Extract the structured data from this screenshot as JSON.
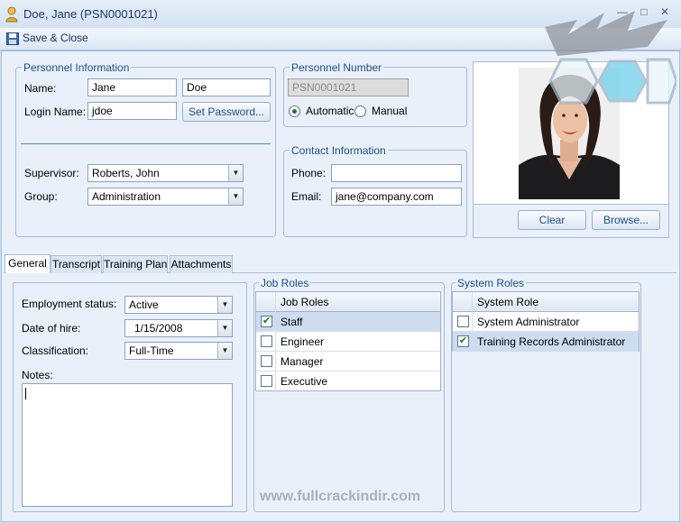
{
  "window": {
    "title": "Doe, Jane (PSN0001021)"
  },
  "toolbar": {
    "save_close": "Save & Close"
  },
  "personnel": {
    "legend": "Personnel Information",
    "name_label": "Name:",
    "first_name": "Jane",
    "last_name": "Doe",
    "login_label": "Login Name:",
    "login": "jdoe",
    "set_password": "Set Password...",
    "supervisor_label": "Supervisor:",
    "supervisor": "Roberts, John",
    "group_label": "Group:",
    "group": "Administration"
  },
  "personnel_number": {
    "legend": "Personnel Number",
    "value": "PSN0001021",
    "automatic": "Automatic",
    "manual": "Manual",
    "selected": "Automatic"
  },
  "contact": {
    "legend": "Contact Information",
    "phone_label": "Phone:",
    "phone": "",
    "email_label": "Email:",
    "email": "jane@company.com"
  },
  "photo": {
    "clear": "Clear",
    "browse": "Browse..."
  },
  "tabs": [
    "General",
    "Transcript",
    "Training Plan",
    "Attachments"
  ],
  "general": {
    "employment_label": "Employment status:",
    "employment": "Active",
    "hire_label": "Date of hire:",
    "hire": "1/15/2008",
    "class_label": "Classification:",
    "classification": "Full-Time",
    "notes_label": "Notes:",
    "notes": ""
  },
  "job_roles": {
    "legend": "Job Roles",
    "header": "Job Roles",
    "rows": [
      {
        "label": "Staff",
        "checked": true
      },
      {
        "label": "Engineer",
        "checked": false
      },
      {
        "label": "Manager",
        "checked": false
      },
      {
        "label": "Executive",
        "checked": false
      }
    ]
  },
  "system_roles": {
    "legend": "System Roles",
    "header": "System Role",
    "rows": [
      {
        "label": "System Administrator",
        "checked": false
      },
      {
        "label": "Training Records Administrator",
        "checked": true
      }
    ]
  },
  "watermark": "www.fullcrackindir.com",
  "colors": {
    "accent": "#1e4f8a",
    "background": "#e9f0f9",
    "selected_row": "#cddcee"
  }
}
